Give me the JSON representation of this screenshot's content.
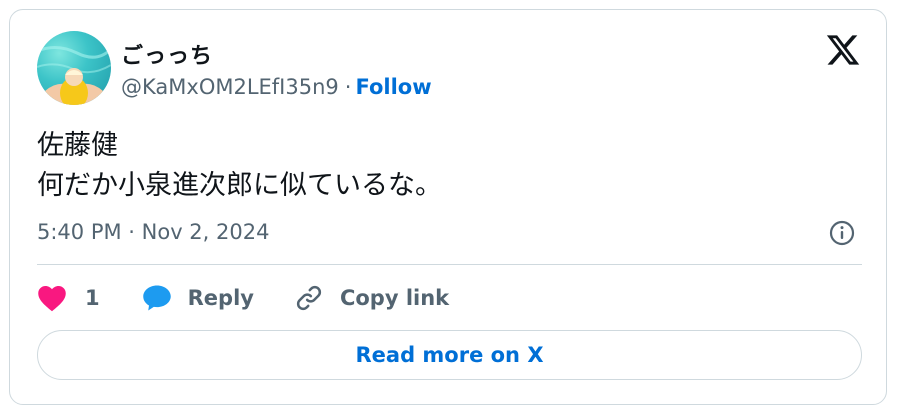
{
  "user": {
    "display_name": "ごっっち",
    "handle": "@KaMxOM2LEfI35n9",
    "separator": "·",
    "follow_label": "Follow"
  },
  "tweet": {
    "text": "佐藤健\n何だか小泉進次郎に似ているな。",
    "timestamp": "5:40 PM · Nov 2, 2024"
  },
  "actions": {
    "like_count": "1",
    "reply_label": "Reply",
    "copy_link_label": "Copy link"
  },
  "read_more_label": "Read more on X",
  "icons": {
    "brand": "x-logo-icon",
    "info": "info-icon",
    "like": "heart-icon",
    "reply": "speech-bubble-icon",
    "copy": "link-icon"
  },
  "colors": {
    "heart": "#f91880",
    "reply_bubble": "#1d9bf0",
    "link_blue": "#006fd6",
    "text_primary": "#0f1419",
    "text_secondary": "#536471",
    "border": "#cfd9de"
  }
}
